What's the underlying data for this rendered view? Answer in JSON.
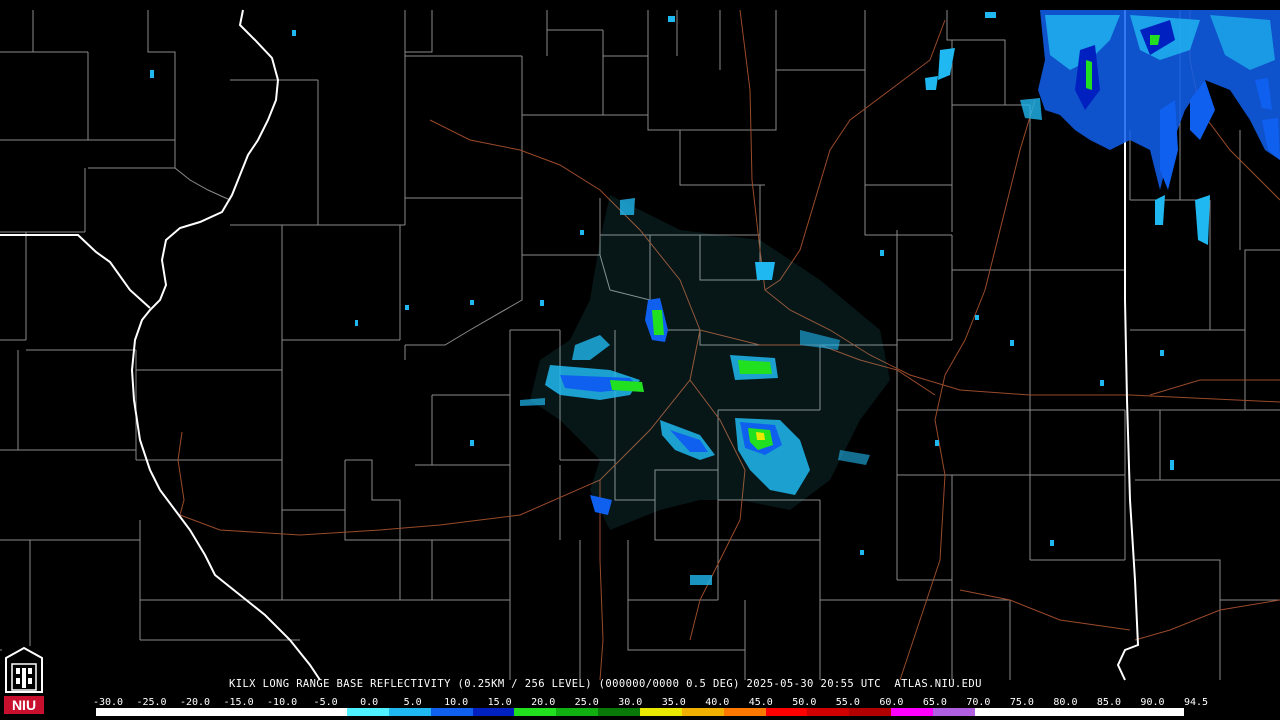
{
  "product": {
    "caption": "KILX LONG RANGE BASE REFLECTIVITY (0.25KM / 256 LEVEL) (000000/0000 0.5 DEG) 2025-05-30 20:55 UTC  ATLAS.NIU.EDU"
  },
  "scale": {
    "labels": [
      "-30.0",
      "-25.0",
      "-20.0",
      "-15.0",
      "-10.0",
      "-5.0",
      "0.0",
      "5.0",
      "10.0",
      "15.0",
      "20.0",
      "25.0",
      "30.0",
      "35.0",
      "40.0",
      "45.0",
      "50.0",
      "55.0",
      "60.0",
      "65.0",
      "70.0",
      "75.0",
      "80.0",
      "85.0",
      "90.0",
      "94.5"
    ],
    "colors": [
      "#ffffff",
      "#ffffff",
      "#ffffff",
      "#ffffff",
      "#ffffff",
      "#ffffff",
      "#4ff0ff",
      "#20b8f0",
      "#1060f0",
      "#0020c0",
      "#20e020",
      "#10b010",
      "#087808",
      "#e8e800",
      "#f0b000",
      "#ff7800",
      "#ff0000",
      "#d00000",
      "#b00000",
      "#ff00ff",
      "#b060e0",
      "#ffffff",
      "#ffffff",
      "#ffffff",
      "#ffffff",
      "#ffffff"
    ]
  },
  "logo": {
    "text": "NIU",
    "color": "#c8102e"
  },
  "map": {
    "county_color": "#8a8a8a",
    "state_color": "#ffffff",
    "road_color": "#9a4a2a",
    "background": "#000000"
  }
}
